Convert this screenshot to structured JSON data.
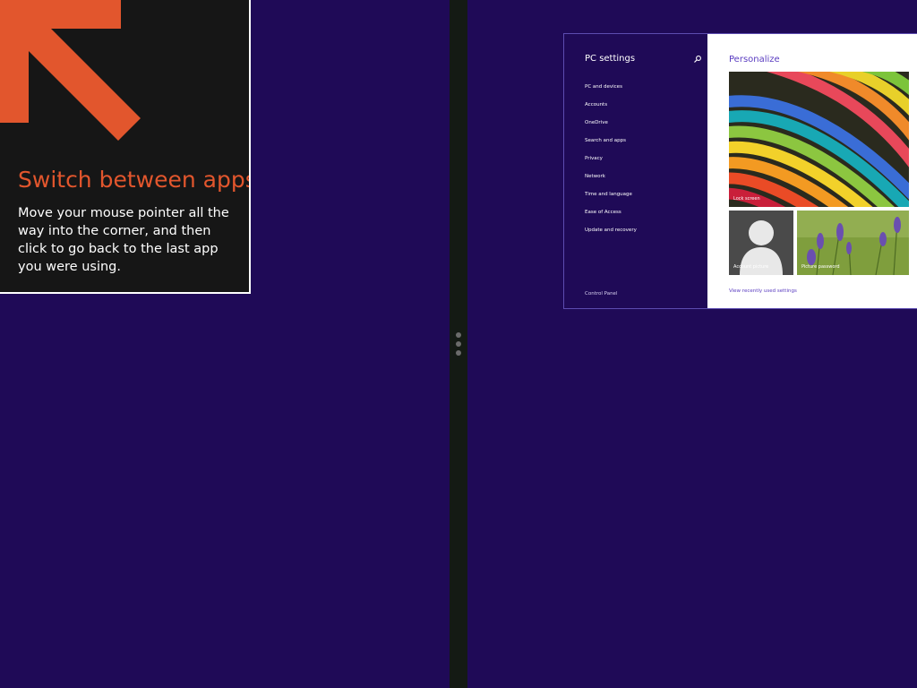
{
  "tip": {
    "title": "Switch between apps",
    "body": "Move your mouse pointer all the way into the corner, and then click to go back to the last app you were using.",
    "arrow_icon": "arrow-up-left-icon",
    "accent_color": "#e2562d"
  },
  "splitter": {
    "grip_icon": "vertical-dots-icon"
  },
  "settings": {
    "nav": {
      "title": "PC settings",
      "search_icon": "search-icon",
      "items": [
        {
          "label": "PC and devices"
        },
        {
          "label": "Accounts"
        },
        {
          "label": "OneDrive"
        },
        {
          "label": "Search and apps"
        },
        {
          "label": "Privacy"
        },
        {
          "label": "Network"
        },
        {
          "label": "Time and language"
        },
        {
          "label": "Ease of Access"
        },
        {
          "label": "Update and recovery"
        }
      ],
      "control_panel": "Control Panel"
    },
    "content": {
      "title": "Personalize",
      "lock_screen_label": "Lock screen",
      "account_picture_label": "Account picture",
      "picture_password_label": "Picture password",
      "recent_link": "View recently used settings"
    }
  },
  "colors": {
    "desktop_background": "#1f0a57",
    "link_color": "#5a3cc0"
  }
}
